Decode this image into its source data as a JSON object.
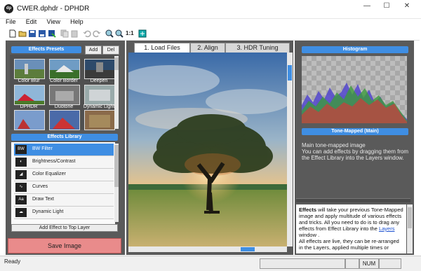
{
  "window": {
    "app_icon": "dp",
    "title": "CWER.dphdr - DPHDR",
    "minimize_glyph": "—",
    "maximize_glyph": "☐",
    "close_glyph": "✕"
  },
  "menu": [
    {
      "label": "File"
    },
    {
      "label": "Edit"
    },
    {
      "label": "View"
    },
    {
      "label": "Help"
    }
  ],
  "toolbar": {
    "zoom_label": "1:1",
    "icons": [
      "new-file-icon",
      "open-folder-icon",
      "save-icon",
      "save-as-icon",
      "export-icon",
      "copy-icon",
      "paste-icon",
      "undo-icon",
      "redo-icon",
      "zoom-in-icon",
      "zoom-out-icon",
      "fit-window-icon"
    ]
  },
  "presets": {
    "header": "Effects Presets",
    "add_label": "Add",
    "del_label": "Del",
    "items": [
      {
        "label": "Color Blur"
      },
      {
        "label": "Color Border"
      },
      {
        "label": "Deepen"
      },
      {
        "label": "DPHDR"
      },
      {
        "label": "Duotone"
      },
      {
        "label": "Dynamic Light"
      },
      {
        "label": ""
      },
      {
        "label": ""
      },
      {
        "label": ""
      }
    ]
  },
  "library": {
    "header": "Effects Library",
    "items": [
      {
        "label": "BW Filter",
        "icon": "BW",
        "selected": true
      },
      {
        "label": "Brightness/Contrast",
        "icon": "◐",
        "selected": false
      },
      {
        "label": "Color Equalizer",
        "icon": "◢",
        "selected": false
      },
      {
        "label": "Curves",
        "icon": "∿",
        "selected": false
      },
      {
        "label": "Draw Text",
        "icon": "Aa",
        "selected": false
      },
      {
        "label": "Dynamic Light",
        "icon": "☁",
        "selected": false
      }
    ],
    "add_button": "Add Effect to Top Layer"
  },
  "save_button": "Save Image",
  "tabs": [
    {
      "label": "1. Load Files",
      "active": true
    },
    {
      "label": "2. Align",
      "active": false
    },
    {
      "label": "3. HDR Tuning",
      "active": false
    }
  ],
  "histogram": {
    "header": "Histogram",
    "layer_label": "Tone-Mapped (Main)",
    "description_title": "Main tone-mapped image",
    "description_body": "You can add effects by dragging them from the Effect Library into the Layers window."
  },
  "help": {
    "bold": "Effects",
    "text1": " will take your previous Tone-Mapped image and apply multitude of various effects and tricks. All you need to do is to drag any effects from Effect Library into the ",
    "link": "Layers",
    "text2": " window .",
    "text3": "All effects are live, they can be re-arranged in the Layers, applied multiple times or"
  },
  "status": {
    "text": "Ready",
    "num": "NUM"
  },
  "colors": {
    "accent": "#3f8ee3",
    "panel": "#5a5a5a",
    "save_button": "#e98b8b"
  }
}
